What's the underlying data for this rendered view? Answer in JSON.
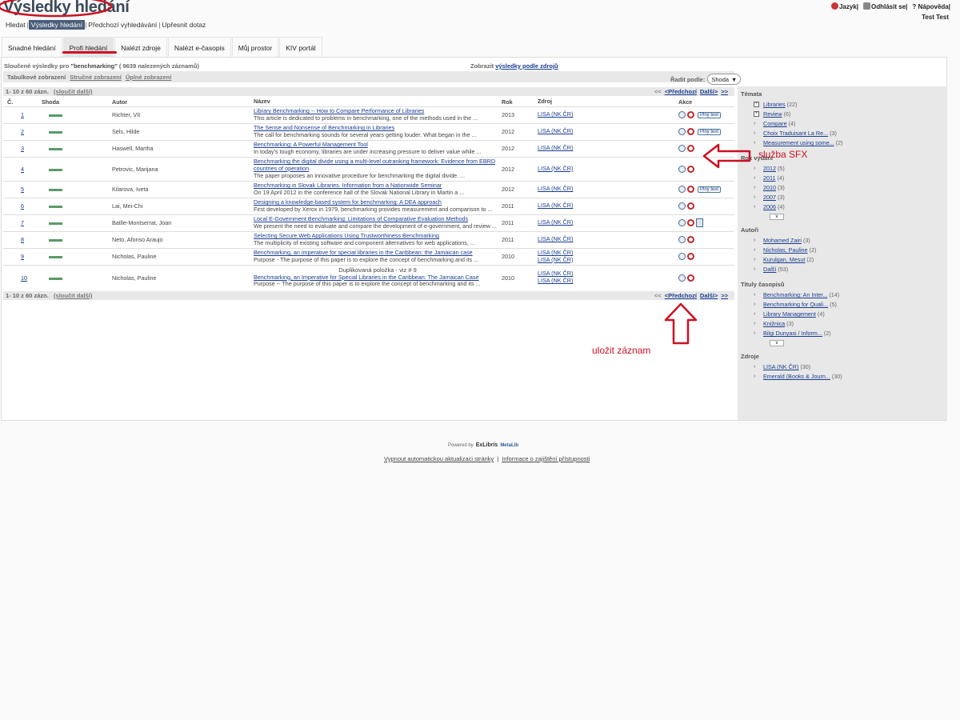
{
  "header": {
    "title": "Výsledky hledání",
    "top_links": {
      "language": "Jazyk",
      "logout": "Odhlásit se",
      "help": "Nápověda"
    },
    "user_name": "Test Test",
    "subnav": [
      "Hledat",
      "Výsledky hledání",
      "Předchozí vyhledávání",
      "Upřesnit dotaz"
    ]
  },
  "tabs": [
    "Snadné hledání",
    "Profi hledání",
    "Nalézt zdroje",
    "Nalézt e-časopis",
    "Můj prostor",
    "KIV portál"
  ],
  "results": {
    "info_prefix": "Sloučené výsledky pro",
    "query": "\"benchmarking\"",
    "info_suffix": "( 9639 nalezených záznamů)",
    "source_link_prefix": "Zobrazit",
    "source_link": "výsledky podle zdrojů",
    "views": [
      "Tabulkové zobrazení",
      "Stručné zobrazení",
      "Úplné zobrazení"
    ],
    "sort_label": "Řadit podle:",
    "sort_value": "Shoda",
    "pager_count": "1- 10 z 60 zázn.",
    "pager_merge": "(sloučit další)",
    "pager_first": "<<",
    "pager_prev": "<Předchozí",
    "pager_next": "Další>",
    "pager_last": ">>",
    "columns": [
      "Č.",
      "Shoda",
      "Autor",
      "Název",
      "Rok",
      "Zdroj",
      "Akce"
    ],
    "full_text_label": "Plný text",
    "duplicate_note": "Duplikovaná položka - viz # 9",
    "rows": [
      {
        "num": "1",
        "author": "Richter, Vít",
        "title": "Library Benchmarking -- How to Compare Performance of Libraries",
        "snippet": "This article is dedicated to problems in benchmarking, one of the methods used in the ...",
        "year": "2013",
        "source": "LISA (NK ČR)",
        "source2": ""
      },
      {
        "num": "2",
        "author": "Sels, Hilde",
        "title": "The Sense and Nonsense of Benchmarking in Libraries",
        "snippet": "The call for benchmarking sounds for several years getting louder. What began in the ...",
        "year": "2012",
        "source": "LISA (NK ČR)",
        "source2": ""
      },
      {
        "num": "3",
        "author": "Haswell, Martha",
        "title": "Benchmarking: A Powerful Management Tool",
        "snippet": "In today's tough economy, libraries are under increasing pressure to deliver value while ...",
        "year": "2012",
        "source": "LISA (NK ČR)",
        "source2": ""
      },
      {
        "num": "4",
        "author": "Petrovic, Marijana",
        "title": "Benchmarking the digital divide using a multi-level outranking framework: Evidence from EBRD countries of operation",
        "snippet": "The paper proposes an innovative procedure for benchmarking the digital divide. ...",
        "year": "2012",
        "source": "LISA (NK ČR)",
        "source2": ""
      },
      {
        "num": "5",
        "author": "Kilarova, Iveta",
        "title": "Benchmarking in Slovak Libraries. Information from a Nationwide Seminar",
        "snippet": "On 19 April 2012 in the conference hall of the Slovak National Library in Martin a ...",
        "year": "2012",
        "source": "LISA (NK ČR)",
        "source2": ""
      },
      {
        "num": "6",
        "author": "Lai, Mei-Chi",
        "title": "Designing a knowledge-based system for benchmarking: A DEA approach",
        "snippet": "First developed by Xerox in 1979, benchmarking provides measurement and comparison to ...",
        "year": "2011",
        "source": "LISA (NK ČR)",
        "source2": ""
      },
      {
        "num": "7",
        "author": "Batlle-Montserrat, Joan",
        "title": "Local E-Government Benchmarking: Limitations of Comparative Evaluation Methods",
        "snippet": "We present the need to evaluate and compare the development of e-government, and review ...",
        "year": "2011",
        "source": "LISA (NK ČR)",
        "source2": ""
      },
      {
        "num": "8",
        "author": "Neto, Afonso Araujo",
        "title": "Selecting Secure Web Applications Using Trustworthiness Benchmarking",
        "snippet": "The multiplicity of existing software and component alternatives for web applications, ...",
        "year": "2011",
        "source": "LISA (NK ČR)",
        "source2": ""
      },
      {
        "num": "9",
        "author": "Nicholas, Pauline",
        "title": "Benchmarking, an imperative for special libraries in the Caribbean: the Jamaican case",
        "snippet": "Purpose - The purpose of this paper is to explore the concept of benchmarking and its ...",
        "year": "2010",
        "source": "LISA (NK ČR)",
        "source2": "LISA (NK ČR)"
      },
      {
        "num": "10",
        "author": "Nicholas, Pauline",
        "title": "Benchmarking, an Imperative for Special Libraries in the Caribbean: The Jamaican Case",
        "snippet": "Purpose -- The purpose of this paper is to explore the concept of benchmarking and its ...",
        "year": "2010",
        "source": "LISA (NK ČR)",
        "source2": "LISA (NK ČR)"
      }
    ]
  },
  "facets": {
    "topics": {
      "label": "Témata",
      "items": [
        {
          "name": "Libraries",
          "count": "(22)"
        },
        {
          "name": "Review",
          "count": "(6)"
        },
        {
          "name": "Compare",
          "count": "(4)"
        },
        {
          "name": "Choix Traduisant La Re...",
          "count": "(3)"
        },
        {
          "name": "Measurement using some...",
          "count": "(2)"
        }
      ]
    },
    "years": {
      "label": "Rok vydání",
      "items": [
        {
          "name": "2012",
          "count": "(5)"
        },
        {
          "name": "2011",
          "count": "(4)"
        },
        {
          "name": "2010",
          "count": "(3)"
        },
        {
          "name": "2007",
          "count": "(3)"
        },
        {
          "name": "2006",
          "count": "(4)"
        }
      ]
    },
    "authors": {
      "label": "Autoři",
      "items": [
        {
          "name": "Mohamed Zairi",
          "count": "(3)"
        },
        {
          "name": "Nicholas, Pauline",
          "count": "(2)"
        },
        {
          "name": "Kurulgan, Mesut",
          "count": "(2)"
        },
        {
          "name": "Další",
          "count": "(53)"
        }
      ]
    },
    "journals": {
      "label": "Tituly časopisů",
      "items": [
        {
          "name": "Benchmarking: An Inter...",
          "count": "(14)"
        },
        {
          "name": "Benchmarking for Quali...",
          "count": "(5)"
        },
        {
          "name": "Library Management",
          "count": "(4)"
        },
        {
          "name": "Knižnica",
          "count": "(3)"
        },
        {
          "name": "Bilgi Dunyasi / Inform...",
          "count": "(2)"
        }
      ]
    },
    "sources": {
      "label": "Zdroje",
      "items": [
        {
          "name": "LISA (NK ČR)",
          "count": "(30)"
        },
        {
          "name": "Emerald (Books & Journ...",
          "count": "(30)"
        }
      ]
    },
    "more_symbol": "∨"
  },
  "annotations": {
    "sfx": "služba SFX",
    "save": "uložit záznam"
  },
  "footer": {
    "powered": "Powered by",
    "brand": "ExLibris",
    "product": "MetaLib",
    "links": [
      "Vypnout automatickou aktualizaci stránky",
      "Informace o zajištění přístupnosti"
    ]
  },
  "colors": {
    "annotation": "#cc1122",
    "link": "#1a3d8f",
    "active_nav": "#4a5e7a",
    "score": "#5a9a6a"
  }
}
